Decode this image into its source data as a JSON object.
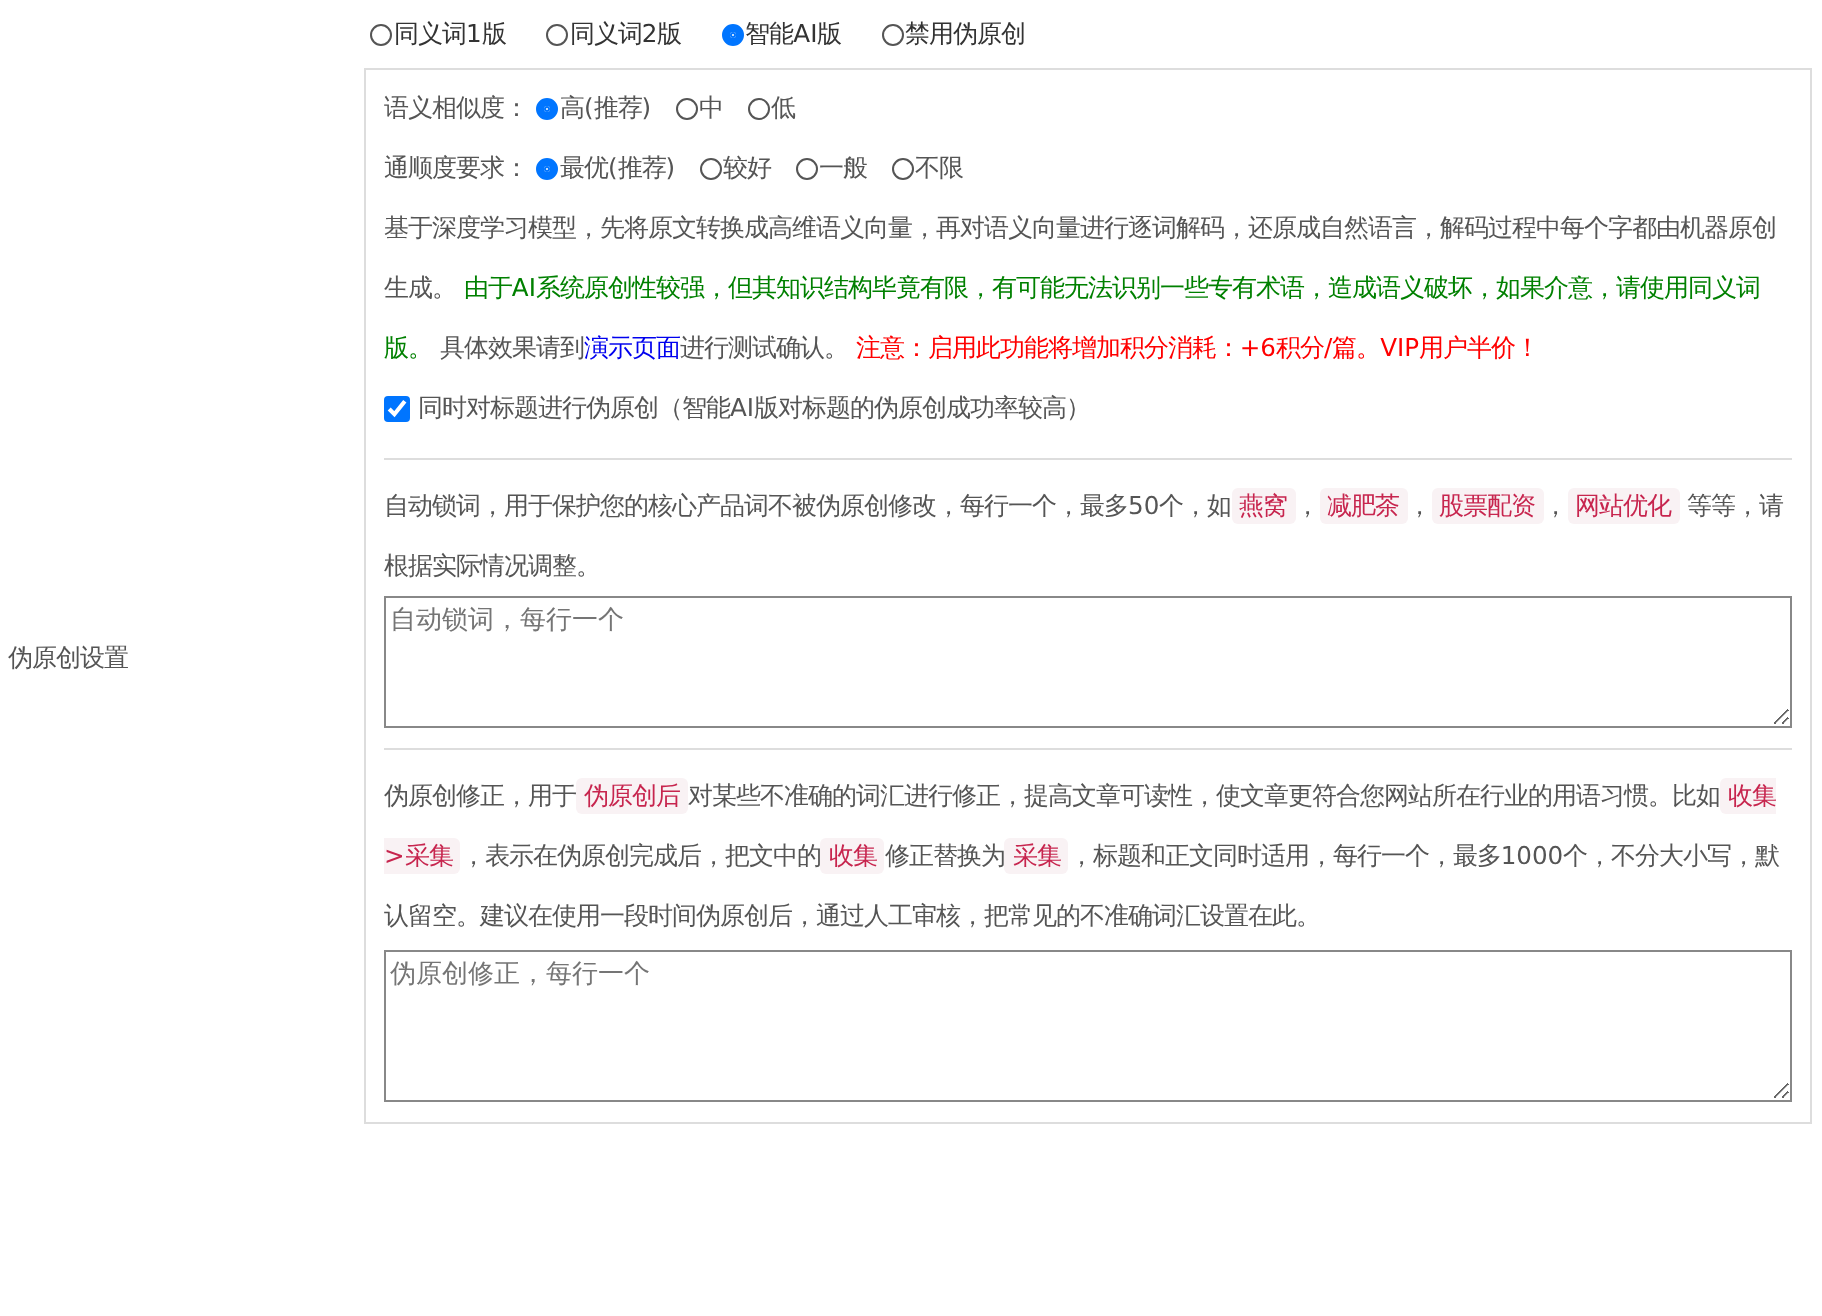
{
  "settings_label": "伪原创设置",
  "modes": [
    {
      "label": "同义词1版",
      "selected": false
    },
    {
      "label": "同义词2版",
      "selected": false
    },
    {
      "label": "智能AI版",
      "selected": true
    },
    {
      "label": "禁用伪原创",
      "selected": false
    }
  ],
  "similarity": {
    "label": "语义相似度：",
    "options": [
      {
        "label": "高(推荐)",
        "selected": true
      },
      {
        "label": "中",
        "selected": false
      },
      {
        "label": "低",
        "selected": false
      }
    ]
  },
  "fluency": {
    "label": "通顺度要求：",
    "options": [
      {
        "label": "最优(推荐)",
        "selected": true
      },
      {
        "label": "较好",
        "selected": false
      },
      {
        "label": "一般",
        "selected": false
      },
      {
        "label": "不限",
        "selected": false
      }
    ]
  },
  "ai_description": [
    {
      "kind": "text",
      "text": "基于深度学习模型，先将原文转换成高维语义向量，再对语义向量进行逐词解码，还原成自然语言，解码过程中每个字都由机器原创生成。 "
    },
    {
      "kind": "notice",
      "text": "由于AI系统原创性较强，但其知识结构毕竟有限，有可能无法识别一些专有术语，造成语义破坏，如果介意，请使用同义词版。"
    },
    {
      "kind": "text",
      "text": " 具体效果请到"
    },
    {
      "kind": "link",
      "text": "演示页面"
    },
    {
      "kind": "text",
      "text": "进行测试确认。 "
    },
    {
      "kind": "warning",
      "text": "注意：启用此功能将增加积分消耗：+6积分/篇。VIP用户半价！"
    }
  ],
  "title_option": {
    "label": "同时对标题进行伪原创（智能AI版对标题的伪原创成功率较高）",
    "checked": true
  },
  "lock_words": {
    "description": [
      {
        "kind": "text",
        "text": "自动锁词，用于保护您的核心产品词不被伪原创修改，每行一个，最多50个，如"
      },
      {
        "kind": "code",
        "text": "燕窝"
      },
      {
        "kind": "text",
        "text": "，"
      },
      {
        "kind": "code",
        "text": "减肥茶"
      },
      {
        "kind": "text",
        "text": "，"
      },
      {
        "kind": "code",
        "text": "股票配资"
      },
      {
        "kind": "text",
        "text": "，"
      },
      {
        "kind": "code",
        "text": "网站优化"
      },
      {
        "kind": "text",
        "text": " 等等，请根据实际情况调整。"
      }
    ],
    "placeholder": "自动锁词，每行一个"
  },
  "correction": {
    "description": [
      {
        "kind": "text",
        "text": "伪原创修正，用于"
      },
      {
        "kind": "code",
        "text": "伪原创后"
      },
      {
        "kind": "text",
        "text": "对某些不准确的词汇进行修正，提高文章可读性，使文章更符合您网站所在行业的用语习惯。比如"
      },
      {
        "kind": "code",
        "text": "收集>采集"
      },
      {
        "kind": "text",
        "text": "，表示在伪原创完成后，把文中的"
      },
      {
        "kind": "code",
        "text": "收集"
      },
      {
        "kind": "text",
        "text": "修正替换为"
      },
      {
        "kind": "code",
        "text": "采集"
      },
      {
        "kind": "text",
        "text": "，标题和正文同时适用，每行一个，最多1000个，不分大小写，默认留空。建议在使用一段时间伪原创后，通过人工审核，把常见的不准确词汇设置在此。"
      }
    ],
    "placeholder": "伪原创修正，每行一个"
  }
}
